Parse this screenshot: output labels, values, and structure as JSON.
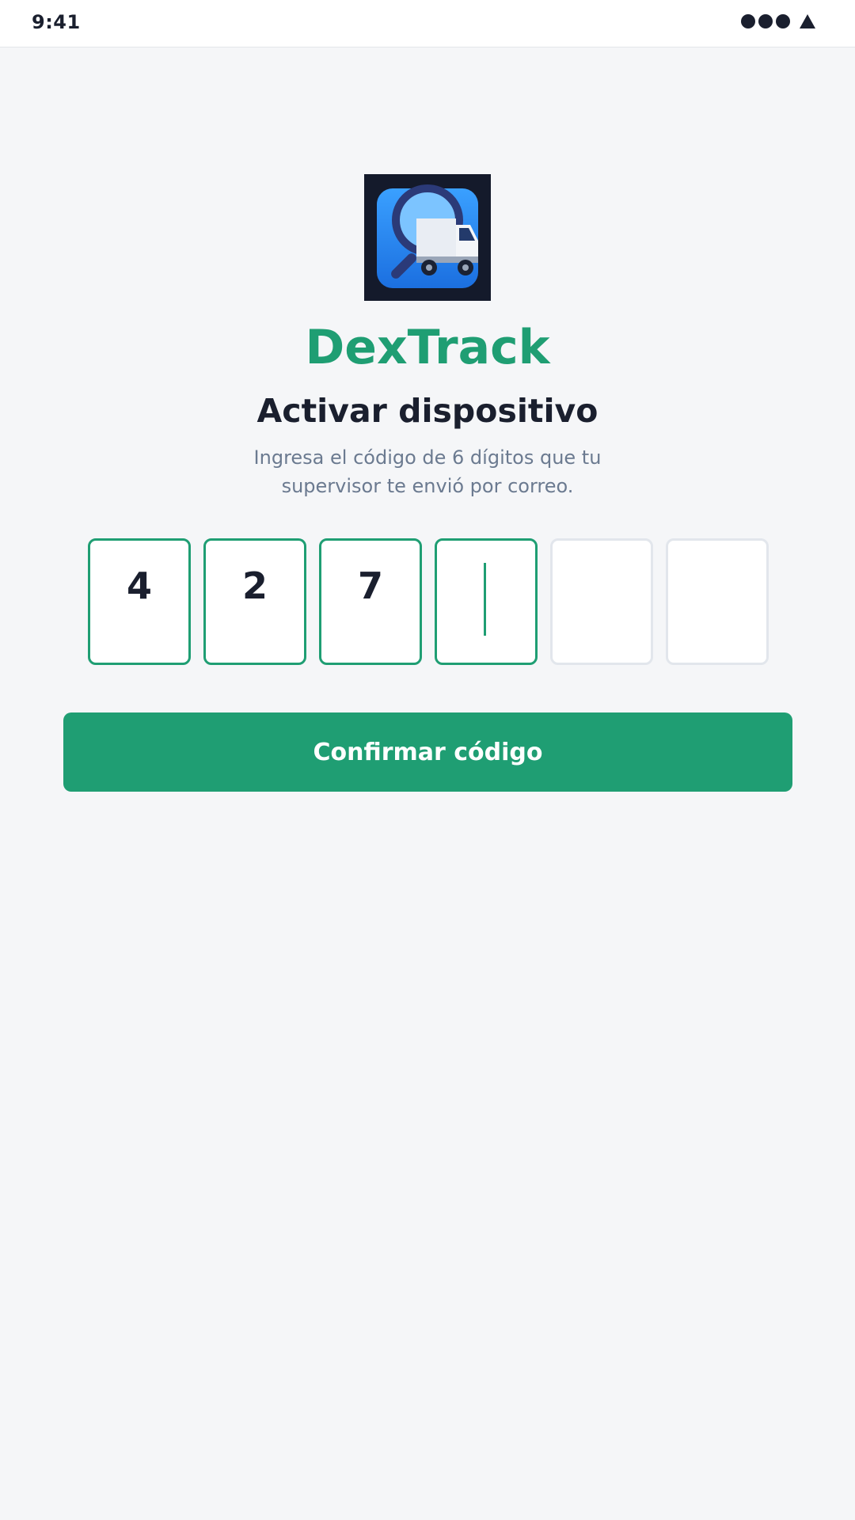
{
  "status_bar": {
    "time": "9:41",
    "icons": [
      "signal-dots-icon",
      "wifi-triangle-icon"
    ]
  },
  "app": {
    "name": "DexTrack",
    "logo_icon": "truck-magnifier-logo"
  },
  "screen": {
    "title": "Activar dispositivo",
    "subtitle": "Ingresa el código de 6 dígitos que tu supervisor te envió por correo."
  },
  "code_input": {
    "digits": [
      "4",
      "2",
      "7",
      "",
      "",
      ""
    ],
    "active_index": 3
  },
  "actions": {
    "confirm_label": "Confirmar código"
  },
  "colors": {
    "accent": "#1f9e73",
    "text_dark": "#1a1f2e",
    "text_muted": "#6b7a90",
    "background": "#f5f6f8",
    "box_border_inactive": "#e2e6ec"
  }
}
